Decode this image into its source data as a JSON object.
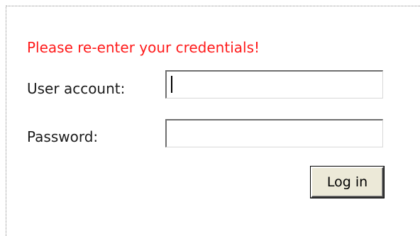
{
  "form": {
    "error_message": "Please re-enter your credentials!",
    "user_label": "User account:",
    "user_value": "",
    "password_label": "Password:",
    "password_value": "",
    "submit_label": "Log in",
    "error_color": "#ff1a1a"
  }
}
